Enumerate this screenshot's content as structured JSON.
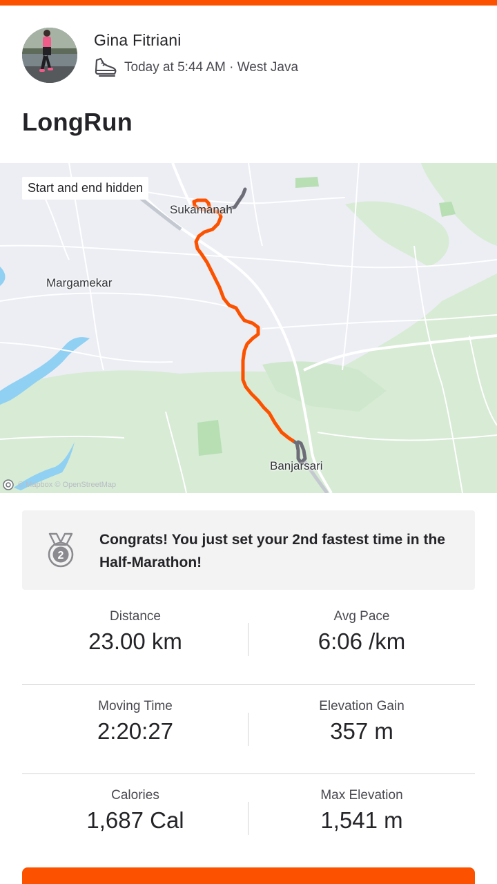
{
  "colors": {
    "brand": "#fc5200",
    "route": "#fc5200",
    "route_hidden": "#6d6d78",
    "water": "#8fd0f3",
    "park": "#cfe9cf"
  },
  "athlete": {
    "name": "Gina Fitriani",
    "activity_type_icon": "running-shoe-icon",
    "meta": "Today at 5:44 AM · West Java"
  },
  "activity": {
    "title": "LongRun"
  },
  "map": {
    "privacy_tag": "Start and end hidden",
    "places": [
      "Sukamanah",
      "Margamekar",
      "Banjarsari"
    ],
    "attribution": "© Mapbox © OpenStreetMap"
  },
  "achievement": {
    "icon": "medal-icon",
    "rank": "2",
    "text": "Congrats! You just set your 2nd fastest time in the Half-Marathon!"
  },
  "stats": [
    [
      {
        "label": "Distance",
        "value": "23.00 km"
      },
      {
        "label": "Avg Pace",
        "value": "6:06 /km"
      }
    ],
    [
      {
        "label": "Moving Time",
        "value": "2:20:27"
      },
      {
        "label": "Elevation Gain",
        "value": "357 m"
      }
    ],
    [
      {
        "label": "Calories",
        "value": "1,687 Cal"
      },
      {
        "label": "Max Elevation",
        "value": "1,541 m"
      }
    ]
  ]
}
